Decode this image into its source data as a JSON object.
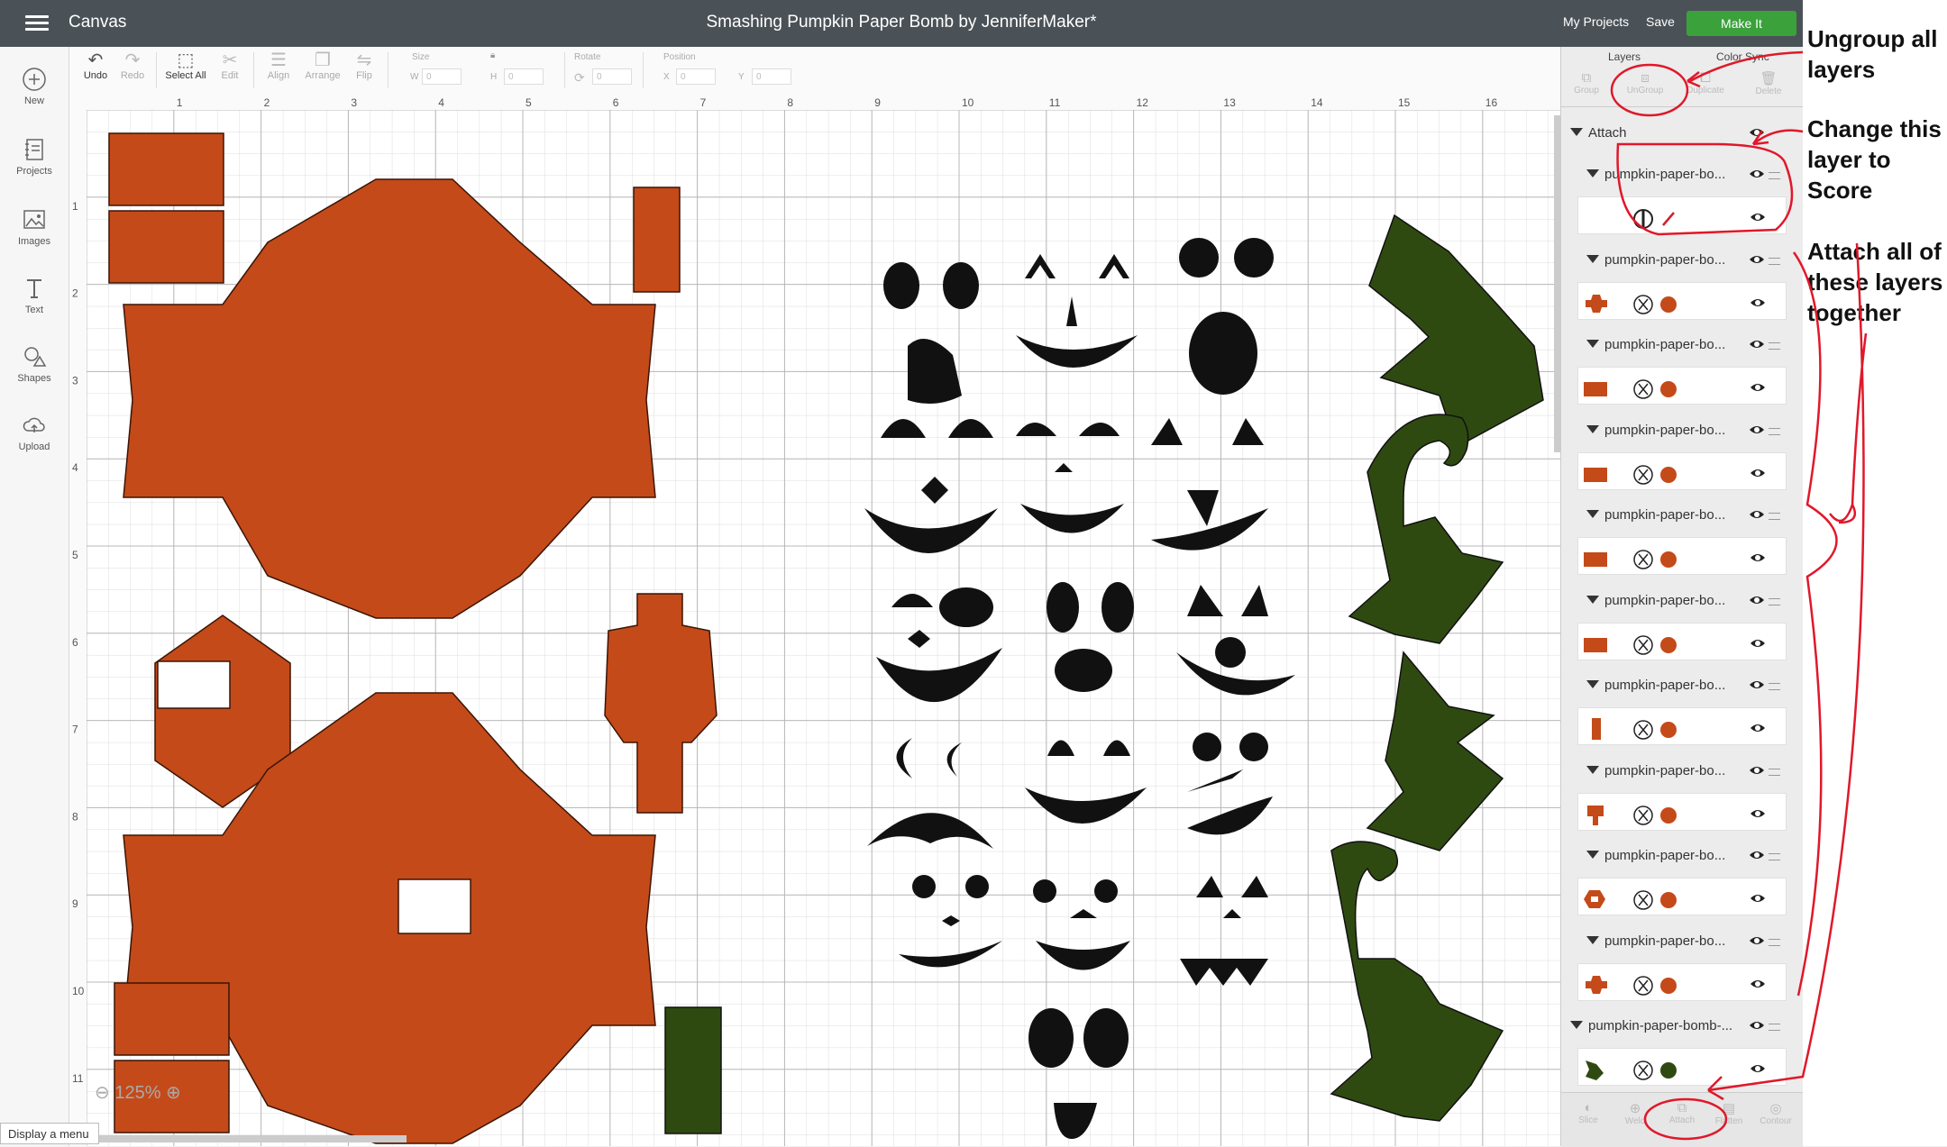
{
  "topbar": {
    "canvas_label": "Canvas",
    "title": "Smashing Pumpkin Paper Bomb by JenniferMaker*",
    "my_projects": "My Projects",
    "save": "Save",
    "make_it": "Make It"
  },
  "leftbar": {
    "new": "New",
    "projects": "Projects",
    "images": "Images",
    "text": "Text",
    "shapes": "Shapes",
    "upload": "Upload"
  },
  "toolbar": {
    "undo": "Undo",
    "redo": "Redo",
    "select_all": "Select All",
    "edit": "Edit",
    "align": "Align",
    "arrange": "Arrange",
    "flip": "Flip",
    "size": "Size",
    "w": "W",
    "h": "H",
    "w_val": "0",
    "h_val": "0",
    "rotate": "Rotate",
    "rotate_val": "0",
    "position": "Position",
    "x": "X",
    "y": "Y",
    "x_val": "0",
    "y_val": "0"
  },
  "ruler": {
    "top": [
      "1",
      "2",
      "3",
      "4",
      "5",
      "6",
      "7",
      "8",
      "9",
      "10",
      "11",
      "12",
      "13",
      "14",
      "15",
      "16"
    ],
    "left": [
      "1",
      "2",
      "3",
      "4",
      "5",
      "6",
      "7",
      "8",
      "9",
      "10",
      "11"
    ]
  },
  "zoom": "125%",
  "display_menu": "Display a menu",
  "panel": {
    "tab_layers": "Layers",
    "tab_color_sync": "Color Sync",
    "tools": [
      "Group",
      "UnGroup",
      "Duplicate",
      "Delete"
    ],
    "bottom_tools": [
      "Slice",
      "Weld",
      "Attach",
      "Flatten",
      "Contour"
    ],
    "group_name": "Attach",
    "layers": [
      {
        "name": "pumpkin-paper-bo...",
        "thumb": "score"
      },
      {
        "name": "pumpkin-paper-bo...",
        "thumb": "orange-cross"
      },
      {
        "name": "pumpkin-paper-bo...",
        "thumb": "orange-rect"
      },
      {
        "name": "pumpkin-paper-bo...",
        "thumb": "orange-rect"
      },
      {
        "name": "pumpkin-paper-bo...",
        "thumb": "orange-rect"
      },
      {
        "name": "pumpkin-paper-bo...",
        "thumb": "orange-rect"
      },
      {
        "name": "pumpkin-paper-bo...",
        "thumb": "orange-thin"
      },
      {
        "name": "pumpkin-paper-bo...",
        "thumb": "orange-pin"
      },
      {
        "name": "pumpkin-paper-bo...",
        "thumb": "orange-hex"
      },
      {
        "name": "pumpkin-paper-bo...",
        "thumb": "orange-cross"
      }
    ],
    "last_layer": {
      "name": "pumpkin-paper-bomb-...",
      "thumb": "green-hat"
    }
  },
  "annotations": [
    "Ungroup all layers",
    "Change this layer to Score",
    "Attach all of these layers together"
  ],
  "colors": {
    "orange": "#c44a1a",
    "green": "#2f4a11",
    "make_it": "#3ba13b",
    "topbar": "#4b5257",
    "annotation_red": "#e0182a"
  }
}
